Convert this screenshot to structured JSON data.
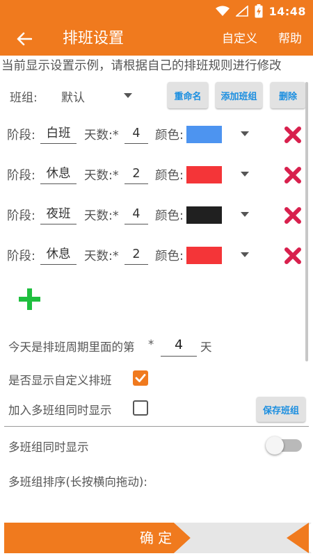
{
  "status_bar": {
    "time": "14:48"
  },
  "app_bar": {
    "title": "排班设置",
    "actions": [
      "自定义",
      "帮助"
    ],
    "color": "#f07a1e"
  },
  "notice": "当前显示设置示例，请根据自己的排班规则进行修改",
  "group": {
    "label": "班组:",
    "value": "默认",
    "buttons": [
      "重命名",
      "添加班组",
      "删除"
    ]
  },
  "stage_labels": {
    "stage": "阶段:",
    "days": "天数:*",
    "color": "颜色:"
  },
  "stages": [
    {
      "name": "白班",
      "days": "4",
      "color": "#4d94f0"
    },
    {
      "name": "休息",
      "days": "2",
      "color": "#f43538"
    },
    {
      "name": "夜班",
      "days": "4",
      "color": "#202020"
    },
    {
      "name": "休息",
      "days": "2",
      "color": "#f43538"
    }
  ],
  "today": {
    "prefix": "今天是排班周期里面的第",
    "star": "*",
    "value": "4",
    "suffix": "天"
  },
  "options": [
    {
      "label": "是否显示自定义排班",
      "checked": true
    },
    {
      "label": "加入多班组同时显示",
      "checked": false
    }
  ],
  "save_button": "保存班组",
  "multi_display": {
    "label": "多班组同时显示",
    "enabled": false
  },
  "sort_label": "多班组排序(长按横向拖动):",
  "confirm_label": "确 定",
  "icons": [
    "wifi-icon",
    "signal-icon",
    "battery-charging-icon",
    "back-arrow-icon",
    "dropdown-caret-icon",
    "remove-x-icon",
    "add-plus-icon",
    "checkbox-icon",
    "toggle-switch-icon"
  ]
}
